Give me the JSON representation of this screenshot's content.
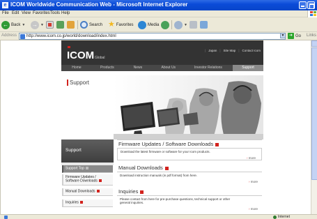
{
  "window": {
    "title": "ICOM Worldwide Communication Web - Microsoft Internet Explorer"
  },
  "menu": [
    "File",
    "Edit",
    "View",
    "Favorites",
    "Tools",
    "Help"
  ],
  "toolbar": {
    "back": "Back",
    "search": "Search",
    "favorites": "Favorites",
    "media": "Media"
  },
  "address": {
    "label": "Address",
    "url": "http://www.icom.co.jp/world/download/index.html",
    "go": "Go",
    "links": "Links"
  },
  "status": {
    "zone": "Internet"
  },
  "site": {
    "logo": "ICOM",
    "logo_sub": "Global",
    "util_links": [
      "Japan",
      "Site Map",
      "Contact Icom"
    ],
    "nav": [
      "Home",
      "Products",
      "News",
      "About Us",
      "Investor Relations",
      "Support"
    ],
    "hero_title": "Support",
    "sidebar_title": "Support",
    "sidebar_items": [
      {
        "line1": "Support Top",
        "line2": ""
      },
      {
        "line1": "Firmware Updates /",
        "line2": "Software Downloads"
      },
      {
        "line1": "Manual Downloads",
        "line2": ""
      },
      {
        "line1": "Inquiries",
        "line2": ""
      }
    ],
    "sections": [
      {
        "title": "Firmware Updates / Software Downloads",
        "desc": "Download the latest firmware or software for your Icom products.",
        "more": "more"
      },
      {
        "title": "Manual Downloads",
        "desc": "Download instruction manuals (in pdf format) from here.",
        "more": "more"
      },
      {
        "title": "Inquiries",
        "desc": "Please contact from here for pre-purchase questions, technical support or other general inquiries.",
        "more": "more"
      }
    ]
  },
  "colors": {
    "titlebar": "#0a4bd8",
    "chrome": "#ece9d8",
    "site_dark": "#333333",
    "accent_red": "#d2231e"
  }
}
